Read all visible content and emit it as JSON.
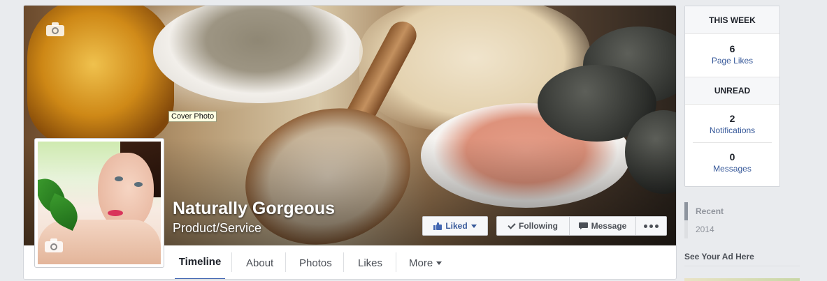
{
  "page": {
    "name": "Naturally Gorgeous",
    "category": "Product/Service",
    "cover_tooltip": "Cover Photo"
  },
  "actions": {
    "liked_label": "Liked",
    "following_label": "Following",
    "message_label": "Message"
  },
  "nav": {
    "tabs": [
      {
        "label": "Timeline",
        "active": true
      },
      {
        "label": "About"
      },
      {
        "label": "Photos"
      },
      {
        "label": "Likes"
      },
      {
        "label": "More"
      }
    ]
  },
  "sidebar": {
    "this_week_title": "THIS WEEK",
    "page_likes_count": "6",
    "page_likes_label": "Page Likes",
    "unread_title": "UNREAD",
    "notifications_count": "2",
    "notifications_label": "Notifications",
    "messages_count": "0",
    "messages_label": "Messages",
    "years": [
      {
        "label": "Recent",
        "active": true
      },
      {
        "label": "2014"
      }
    ],
    "ad_heading": "See Your Ad Here"
  },
  "colors": {
    "accent": "#4267b2",
    "link": "#365899",
    "background": "#e9ebee"
  }
}
